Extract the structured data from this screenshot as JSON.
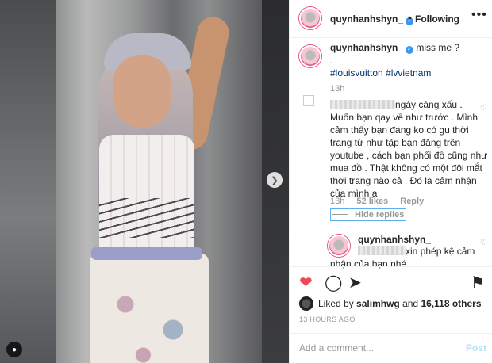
{
  "header": {
    "username": "quynhanhshyn_",
    "separator": "•",
    "follow_state": "Following",
    "more_icon": "more-horizontal-icon"
  },
  "caption": {
    "username": "quynhanhshyn_",
    "text": "miss me ?",
    "dot": ".",
    "hashtags": "#louisvuitton #lvvietnam",
    "time": "13h"
  },
  "comment": {
    "text": "ngày càng xấu . Muốn bạn qay về như trước . Mình cảm thấy bạn đang ko có gu thời trang từ như tập bạn đăng trên youtube , cách bạn phối đồ cũng như mua đồ . Thật không có một đôi mắt thời trang nào cả . Đó là cảm nhận của mình ạ",
    "time": "13h",
    "likes": "52 likes",
    "reply": "Reply",
    "hide_replies": "Hide replies"
  },
  "reply": {
    "username": "quynhanhshyn_",
    "text": "xin phép kệ cảm nhận của bạn nhé"
  },
  "actions": {
    "like_icon": "heart-filled-icon",
    "comment_icon": "comment-icon",
    "share_icon": "share-icon",
    "save_icon": "bookmark-icon"
  },
  "likes": {
    "prefix": "Liked by",
    "user": "salimhwg",
    "and": "and",
    "count": "16,118 others"
  },
  "post_time": "13 HOURS AGO",
  "add_comment": {
    "placeholder": "Add a comment...",
    "post_label": "Post"
  },
  "colors": {
    "like_red": "#ed4956",
    "link_blue": "#003569",
    "verified_blue": "#3897f0",
    "post_disabled": "#b2dffc"
  }
}
